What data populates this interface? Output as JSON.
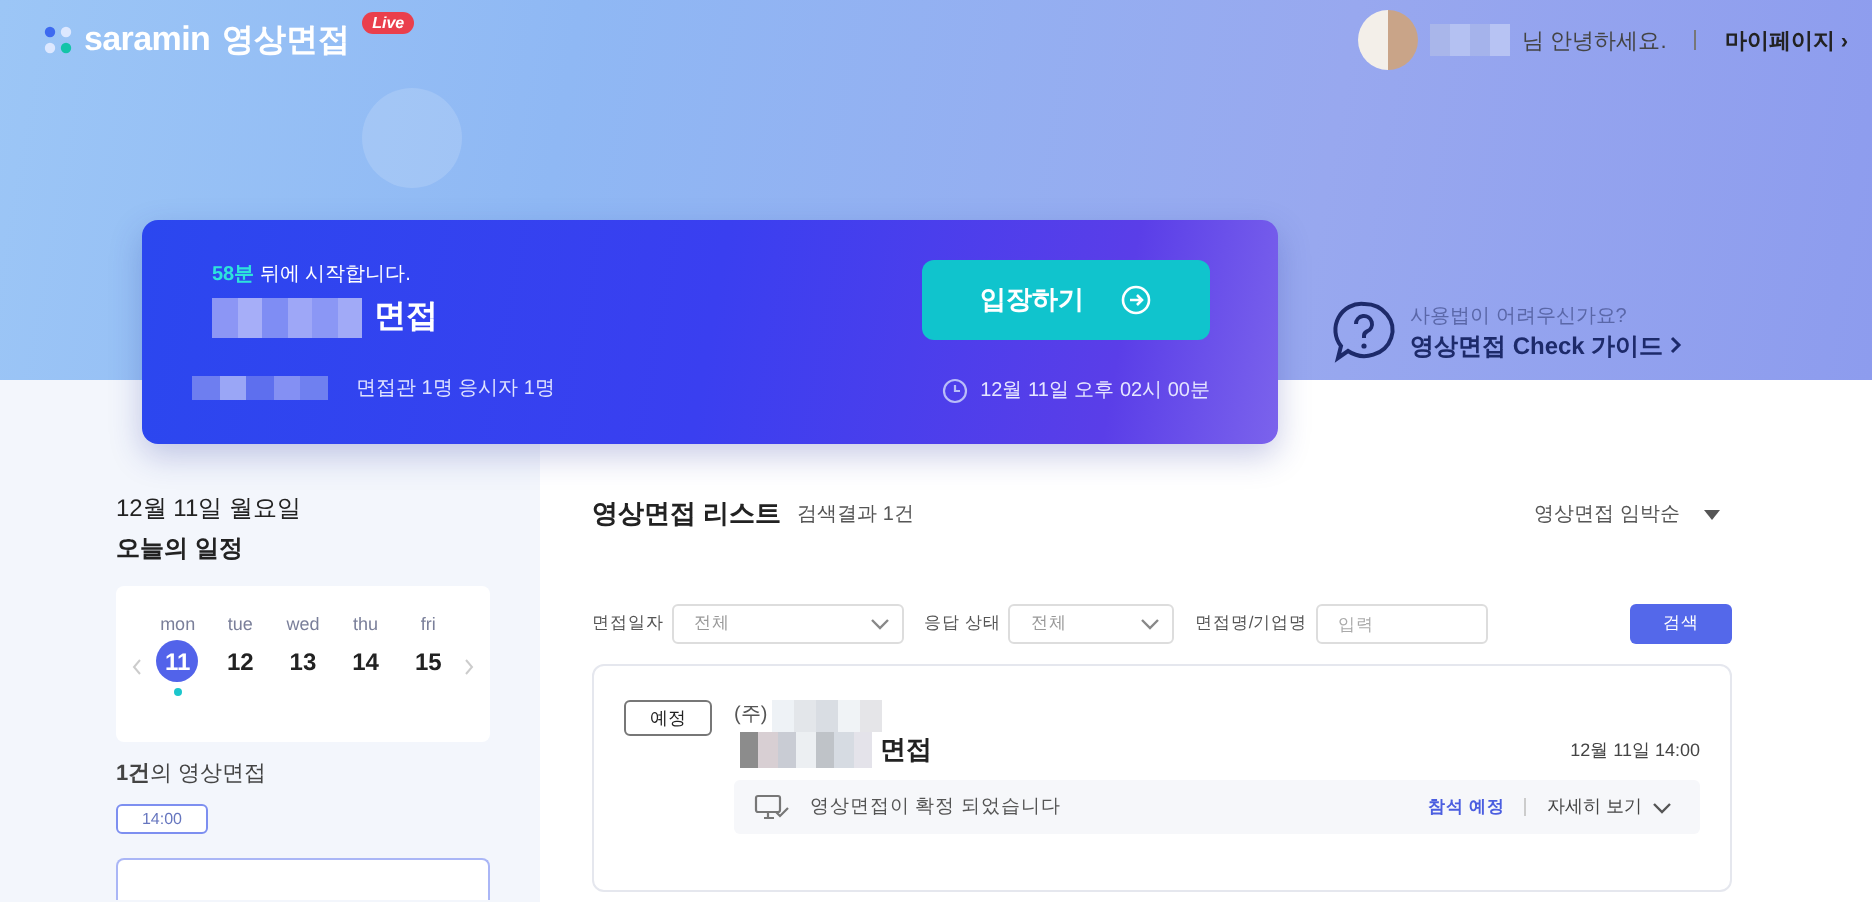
{
  "header": {
    "logo_text": "saramin",
    "service_name": "영상면접",
    "badge": "Live",
    "greeting": "님 안녕하세요.",
    "mypage_link": "마이페이지 ›"
  },
  "upcoming": {
    "countdown": "58분",
    "countdown_suffix": "뒤에 시작합니다.",
    "title_suffix": "면접",
    "participants": "면접관 1명  응시자 1명",
    "enter_button": "입장하기",
    "datetime": "12월 11일 오후 02시 00분"
  },
  "guide": {
    "question": "사용법이 어려우신가요?",
    "link": "영상면접 Check 가이드"
  },
  "sidebar": {
    "date": "12월 11일 월요일",
    "title": "오늘의 일정",
    "week": [
      {
        "weekday": "mon",
        "day": "11",
        "selected": true,
        "has_event": true
      },
      {
        "weekday": "tue",
        "day": "12",
        "selected": false,
        "has_event": false
      },
      {
        "weekday": "wed",
        "day": "13",
        "selected": false,
        "has_event": false
      },
      {
        "weekday": "thu",
        "day": "14",
        "selected": false,
        "has_event": false
      },
      {
        "weekday": "fri",
        "day": "15",
        "selected": false,
        "has_event": false
      }
    ],
    "count_text": "**1건**의 영상면접",
    "times": [
      "14:00"
    ]
  },
  "list": {
    "title": "영상면접 리스트",
    "result": "검색결과 1건",
    "sort": "영상면접 임박순",
    "filters": [
      {
        "kind": "select",
        "label": "면접일자",
        "placeholder": "전체"
      },
      {
        "kind": "select",
        "label": "응답 상태",
        "placeholder": "전체"
      },
      {
        "kind": "input",
        "label": "면접명/기업명",
        "placeholder": "입력"
      }
    ],
    "search_button": "검색",
    "items": [
      {
        "status": "예정",
        "company_prefix": "(주)",
        "title_suffix": "면접",
        "datetime": "12월 11일 14:00",
        "message": "영상면접이 확정 되었습니다",
        "attendance": "참석 예정",
        "details": "자세히 보기"
      }
    ]
  }
}
